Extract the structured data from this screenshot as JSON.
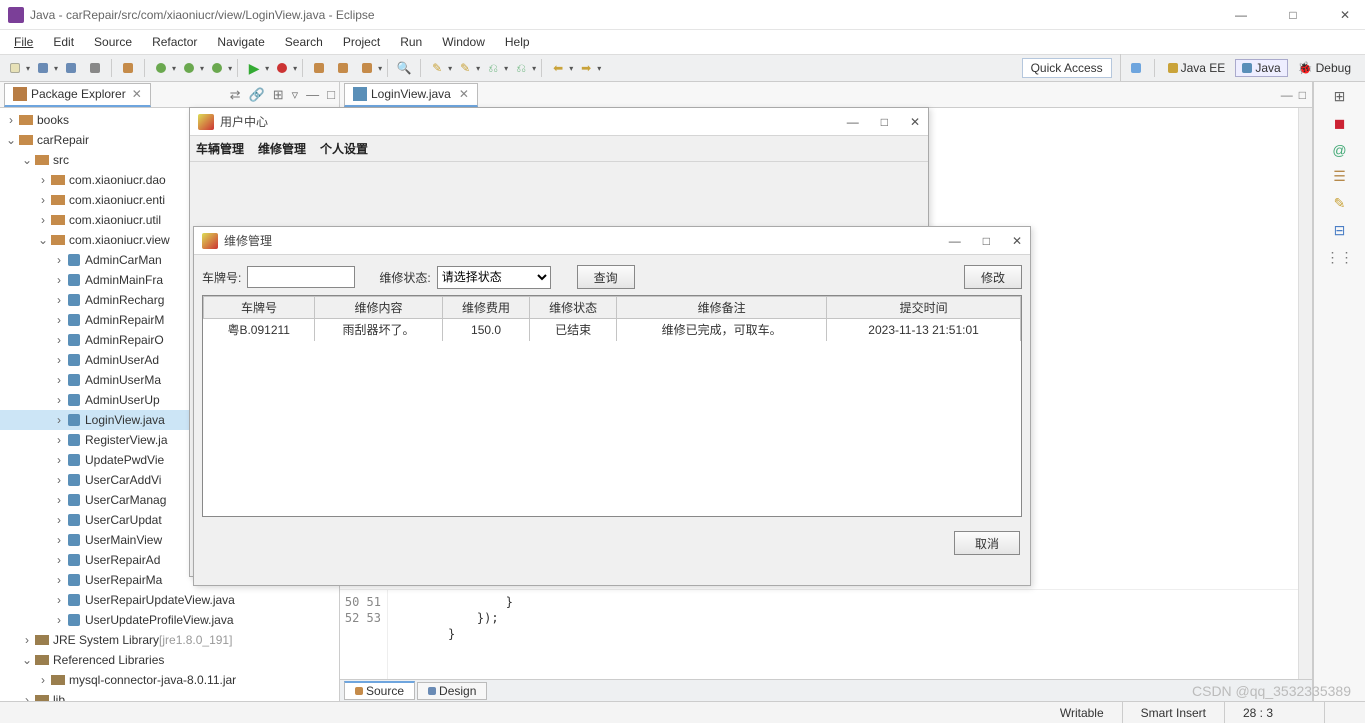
{
  "window": {
    "title": "Java - carRepair/src/com/xiaoniucr/view/LoginView.java - Eclipse",
    "min": "—",
    "max": "□",
    "close": "✕"
  },
  "menu": [
    "File",
    "Edit",
    "Source",
    "Refactor",
    "Navigate",
    "Search",
    "Project",
    "Run",
    "Window",
    "Help"
  ],
  "toolbar": {
    "quick_access": "Quick Access"
  },
  "perspectives": {
    "javaee": "Java EE",
    "java": "Java",
    "debug": "Debug"
  },
  "explorer": {
    "title": "Package Explorer",
    "nodes": [
      {
        "d": 0,
        "tw": ">",
        "ic": "fld",
        "lbl": "books"
      },
      {
        "d": 0,
        "tw": "v",
        "ic": "fld",
        "lbl": "carRepair"
      },
      {
        "d": 1,
        "tw": "v",
        "ic": "pkg",
        "lbl": "src"
      },
      {
        "d": 2,
        "tw": ">",
        "ic": "pkg",
        "lbl": "com.xiaoniucr.dao"
      },
      {
        "d": 2,
        "tw": ">",
        "ic": "pkg",
        "lbl": "com.xiaoniucr.enti"
      },
      {
        "d": 2,
        "tw": ">",
        "ic": "pkg",
        "lbl": "com.xiaoniucr.util"
      },
      {
        "d": 2,
        "tw": "v",
        "ic": "pkg",
        "lbl": "com.xiaoniucr.view"
      },
      {
        "d": 3,
        "tw": ">",
        "ic": "cls",
        "lbl": "AdminCarMan"
      },
      {
        "d": 3,
        "tw": ">",
        "ic": "cls",
        "lbl": "AdminMainFra"
      },
      {
        "d": 3,
        "tw": ">",
        "ic": "cls",
        "lbl": "AdminRecharg"
      },
      {
        "d": 3,
        "tw": ">",
        "ic": "cls",
        "lbl": "AdminRepairM"
      },
      {
        "d": 3,
        "tw": ">",
        "ic": "cls",
        "lbl": "AdminRepairO"
      },
      {
        "d": 3,
        "tw": ">",
        "ic": "cls",
        "lbl": "AdminUserAd"
      },
      {
        "d": 3,
        "tw": ">",
        "ic": "cls",
        "lbl": "AdminUserMa"
      },
      {
        "d": 3,
        "tw": ">",
        "ic": "cls",
        "lbl": "AdminUserUp"
      },
      {
        "d": 3,
        "tw": ">",
        "ic": "cls",
        "lbl": "LoginView.java",
        "sel": true
      },
      {
        "d": 3,
        "tw": ">",
        "ic": "cls",
        "lbl": "RegisterView.ja"
      },
      {
        "d": 3,
        "tw": ">",
        "ic": "cls",
        "lbl": "UpdatePwdVie"
      },
      {
        "d": 3,
        "tw": ">",
        "ic": "cls",
        "lbl": "UserCarAddVi"
      },
      {
        "d": 3,
        "tw": ">",
        "ic": "cls",
        "lbl": "UserCarManag"
      },
      {
        "d": 3,
        "tw": ">",
        "ic": "cls",
        "lbl": "UserCarUpdat"
      },
      {
        "d": 3,
        "tw": ">",
        "ic": "cls",
        "lbl": "UserMainView"
      },
      {
        "d": 3,
        "tw": ">",
        "ic": "cls",
        "lbl": "UserRepairAd"
      },
      {
        "d": 3,
        "tw": ">",
        "ic": "cls",
        "lbl": "UserRepairMa"
      },
      {
        "d": 3,
        "tw": ">",
        "ic": "cls",
        "lbl": "UserRepairUpdateView.java"
      },
      {
        "d": 3,
        "tw": ">",
        "ic": "cls",
        "lbl": "UserUpdateProfileView.java"
      },
      {
        "d": 1,
        "tw": ">",
        "ic": "lib",
        "lbl": "JRE System Library ",
        "gray": "[jre1.8.0_191]"
      },
      {
        "d": 1,
        "tw": "v",
        "ic": "lib",
        "lbl": "Referenced Libraries"
      },
      {
        "d": 2,
        "tw": ">",
        "ic": "lib",
        "lbl": "mysql-connector-java-8.0.11.jar"
      },
      {
        "d": 1,
        "tw": ">",
        "ic": "lib",
        "lbl": "lib"
      }
    ]
  },
  "editor": {
    "tab": "LoginView.java",
    "gutter": [
      "50",
      "51",
      "52",
      "53"
    ],
    "lines": [
      "        }",
      "    });",
      "}",
      ""
    ],
    "source_tab": "Source",
    "design_tab": "Design"
  },
  "jwin1": {
    "title": "用户中心",
    "menu": [
      "车辆管理",
      "维修管理",
      "个人设置"
    ]
  },
  "jwin2": {
    "title": "维修管理",
    "form": {
      "plate_label": "车牌号:",
      "status_label": "维修状态:",
      "status_placeholder": "请选择状态",
      "search_btn": "查询",
      "modify_btn": "修改",
      "cancel_btn": "取消"
    },
    "table": {
      "headers": [
        "车牌号",
        "维修内容",
        "维修费用",
        "维修状态",
        "维修备注",
        "提交时间"
      ],
      "rows": [
        [
          "粤B.091211",
          "雨刮器坏了。",
          "150.0",
          "已结束",
          "维修已完成，可取车。",
          "2023-11-13 21:51:01"
        ]
      ]
    }
  },
  "status": {
    "writable": "Writable",
    "insert": "Smart Insert",
    "pos": "28 : 3"
  },
  "watermark": "CSDN @qq_3532335389"
}
